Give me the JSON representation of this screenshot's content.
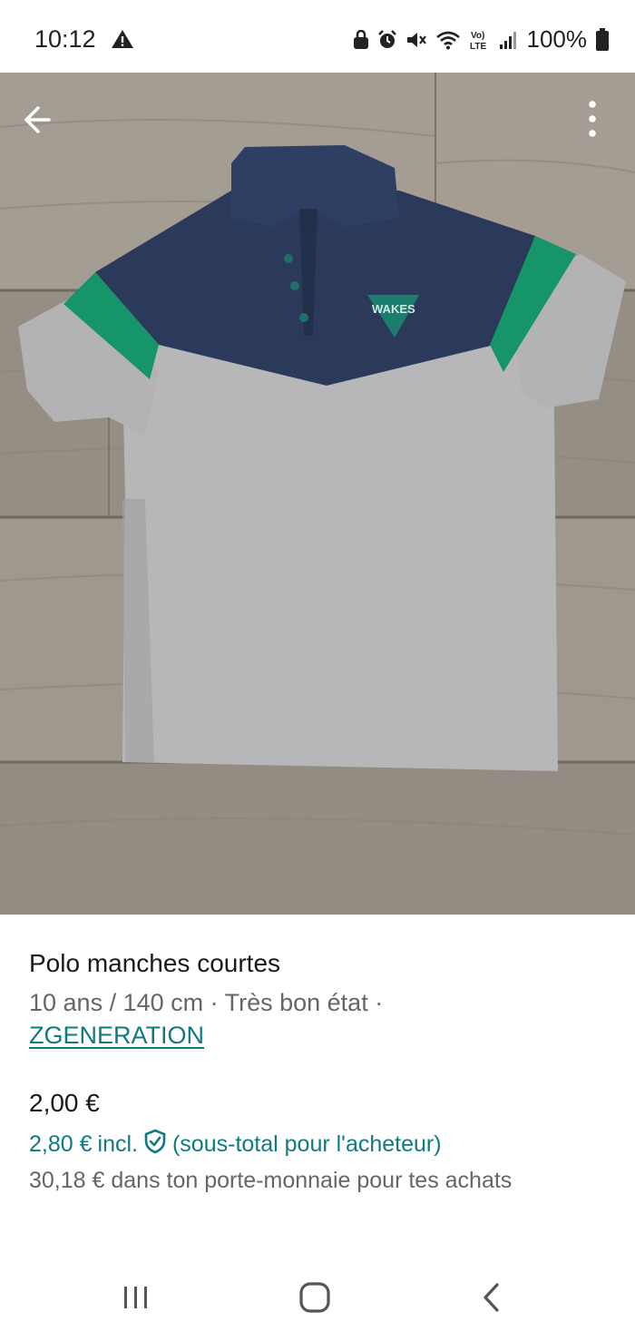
{
  "status_bar": {
    "time": "10:12",
    "battery": "100%",
    "icons": [
      "warning-icon",
      "lock-icon",
      "alarm-icon",
      "mute-icon",
      "wifi-icon",
      "volte-icon",
      "signal-icon",
      "battery-icon"
    ]
  },
  "gallery": {
    "image_count": 4,
    "active_index": 0
  },
  "item": {
    "title": "Polo manches courtes",
    "meta": "10 ans / 140 cm · Très bon état ·",
    "brand": "ZGENERATION",
    "price": "2,00 €",
    "price_incl": "2,80 €",
    "incl_label": "incl.",
    "incl_note": "(sous-total pour l'acheteur)",
    "wallet_note": "30,18 € dans ton porte-monnaie pour tes achats"
  },
  "colors": {
    "accent": "#0f7a80",
    "text_primary": "#1a1a1a",
    "text_secondary": "#666666"
  }
}
